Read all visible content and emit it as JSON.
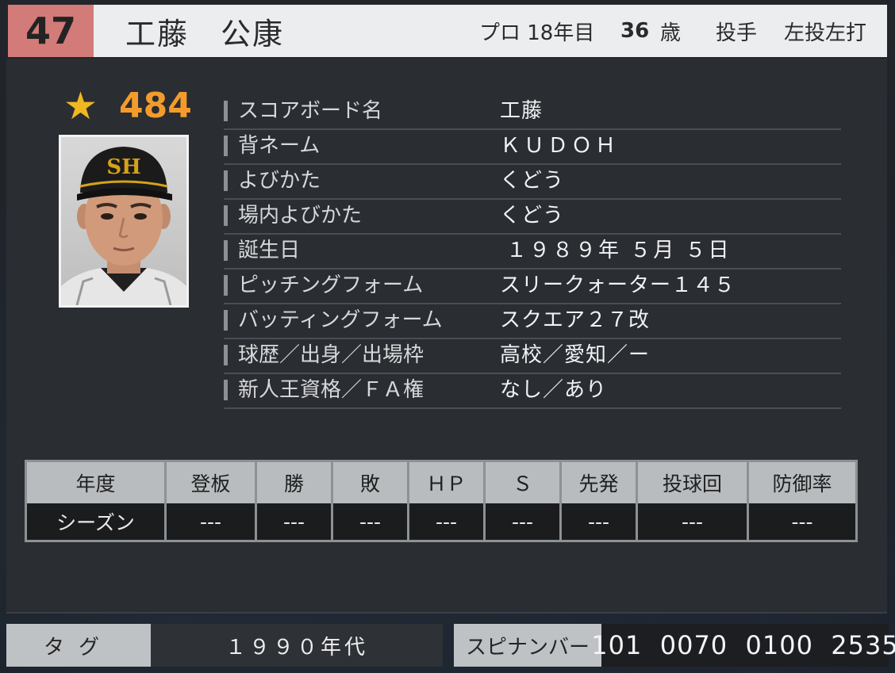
{
  "header": {
    "number": "47",
    "name": "工藤　公康",
    "years": "プロ 18年目",
    "age_value": "36",
    "age_unit": "歳",
    "position": "投手",
    "handedness": "左投左打"
  },
  "rating": {
    "icon": "star-icon",
    "value": "484",
    "color": "#f39b2c"
  },
  "profile": [
    {
      "label": "スコアボード名",
      "value": "工藤"
    },
    {
      "label": "背ネーム",
      "value": "ＫＵＤＯＨ"
    },
    {
      "label": "よびかた",
      "value": "くどう"
    },
    {
      "label": "場内よびかた",
      "value": "くどう"
    },
    {
      "label": "誕生日",
      "value": "１９８９年 ５月 ５日"
    },
    {
      "label": "ピッチングフォーム",
      "value": "スリークォーター１４５"
    },
    {
      "label": "バッティングフォーム",
      "value": "スクエア２７改"
    },
    {
      "label": "球歴／出身／出場枠",
      "value": "高校／愛知／ー"
    },
    {
      "label": "新人王資格／ＦＡ権",
      "value": "なし／あり"
    }
  ],
  "stats": {
    "headers": [
      "年度",
      "登板",
      "勝",
      "敗",
      "ＨＰ",
      "Ｓ",
      "先発",
      "投球回",
      "防御率"
    ],
    "row": [
      "シーズン",
      "---",
      "---",
      "---",
      "---",
      "---",
      "---",
      "---",
      "---"
    ]
  },
  "footer": {
    "tag_label": "タグ",
    "tag_value": "１９９０年代",
    "spin_label": "スピナンバー",
    "spin_value": "101  0070  0100  2535"
  },
  "colors": {
    "number_bg": "#d27b78",
    "star": "#f1b721",
    "header_bg": "#ebedef"
  }
}
